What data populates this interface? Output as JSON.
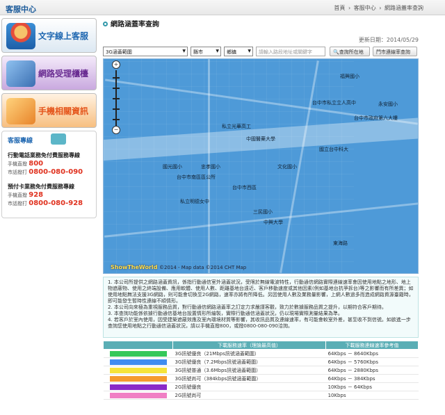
{
  "header": {
    "title": "客服中心",
    "breadcrumbs": [
      "首頁",
      "客服中心",
      "網路涵蓋率查詢"
    ],
    "separator": "›"
  },
  "sidebar": {
    "buttons": [
      {
        "label": "文字線上客服",
        "icon": "agent-icon"
      },
      {
        "label": "網路受理櫃檯",
        "icon": "laptop-icon"
      },
      {
        "label": "手機相關資訊",
        "icon": "phone-info-icon"
      }
    ],
    "hotline": {
      "title": "客服專線",
      "groups": [
        {
          "title": "行動電話業務免付費服務專線",
          "line1_label": "手機直撥",
          "line1_value": "800",
          "line2_label": "市話撥打",
          "line2_value": "0800-080-090"
        },
        {
          "title": "預付卡業務免付費服務專線",
          "line1_label": "手機直撥",
          "line1_value": "928",
          "line2_label": "市話撥打",
          "line2_value": "0800-080-928"
        }
      ]
    }
  },
  "main": {
    "title": "網路涵蓋率查詢",
    "updated": "更新日期：2014/05/29",
    "toolbar": {
      "network": "3G涵蓋範圍",
      "city": "縣市",
      "district": "鄉鎮",
      "address_placeholder": "請輸入路段地址或關鍵字",
      "locate_button": "查詢所在地",
      "rate_button": "門市連線率查詢"
    },
    "map": {
      "zoom_in": "+",
      "zoom_out": "−",
      "labels": [
        "中國醫藥大學",
        "台中市私立立人高中",
        "台中市政府第六大樓",
        "文化國小",
        "中興大學",
        "國立台中科大",
        "國光國小",
        "台中市南區區公所",
        "忠孝國小",
        "東海路",
        "永安國小",
        "福興國小",
        "私立光華高工",
        "私立明德女中",
        "台中市西區",
        "三民國小"
      ],
      "logo": "ShowTheWorld",
      "copyright": "©2014 - Map data ©2014 CHT Map"
    },
    "notes": [
      "1. 本公司所提供之網路涵蓋資訊，係指行動通信室外涵蓋狀況，受限於無線電波特性，行動通信網路實際連線速率會因使用地點之地形、地上物遮蔽物、使用之終端設備、應用軟體、使用人數、距離基地台遠近、客戶移動速度或其他因素(例如基地台抗爭拆台)等之影響而有所差異；如使用地點無法支援3G網路，則可能會切換至2G網路，速率亦將有所降低。另因使用人數及業務量影響，上網人數過多而造成網路資源臺籍時，即可能發生暫時性連線不順情形。",
      "2. 本公司向來極為重視服務品質，對行動通信網路涵蓋率之訂定力求嚴謹客觀，致力於數據服務品質之提升，以期符合客戶期待。",
      "3. 本查詢功能係依據行動通信基地台設置情形所繪製，實際行動通信涵蓋狀況，仍以現場實際測量結果為準。",
      "4. 若客戶於室內使用，因受建築遮蔽效應及室內環境材質等影響，其收訊品質及連線速率，有可能會較室外差，甚至收不到信號。如欲進一步查詢您使用地點之行動通信涵蓋狀況，請以手機直撥800，或撥0800-080-090洽詢。"
    ],
    "legend": {
      "col1": "下載服務速率（理論最高值）",
      "col2": "下載服務連線速率參考值",
      "rows": [
        {
          "color": "#35c85a",
          "service": "3G訊號優良（21Mbps訊號涵蓋範圍）",
          "rate": "64Kbps － 8640Kbps"
        },
        {
          "color": "#3f8cf0",
          "service": "3G訊號優良（7.2Mbps訊號涵蓋範圍）",
          "rate": "64Kbps － 5760Kbps"
        },
        {
          "color": "#f5e33a",
          "service": "3G訊號普通（3.6Mbps訊號涵蓋範圍）",
          "rate": "64Kbps － 2880Kbps"
        },
        {
          "color": "#f59a2e",
          "service": "3G訊號尚可（384kbps訊號涵蓋範圍）",
          "rate": "64Kbps － 384Kbps"
        },
        {
          "color": "#8a2ac8",
          "service": "2G訊號優良",
          "rate": "10Kbps － 64Kbps"
        },
        {
          "color": "#f07fc4",
          "service": "2G訊號尚可",
          "rate": "10Kbps"
        }
      ]
    }
  }
}
